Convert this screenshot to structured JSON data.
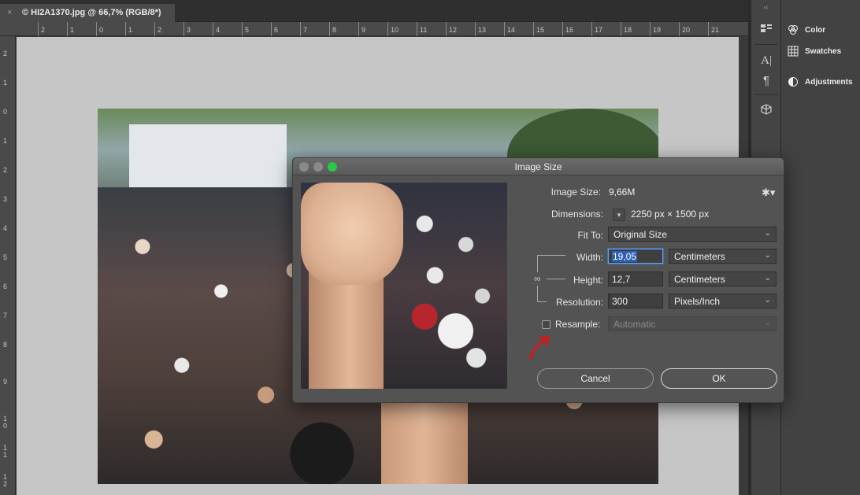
{
  "document_tab": {
    "title": "HI2A1370.jpg @ 66,7% (RGB/8*)",
    "close_glyph": "×",
    "modified_mark": "©"
  },
  "ruler_h": [
    "2",
    "1",
    "0",
    "1",
    "2",
    "3",
    "4",
    "5",
    "6",
    "7",
    "8",
    "9",
    "10",
    "11",
    "12",
    "13",
    "14",
    "15",
    "16",
    "17",
    "18",
    "19",
    "20",
    "21"
  ],
  "ruler_v": [
    "2",
    "1",
    "0",
    "1",
    "2",
    "3",
    "4",
    "5",
    "6",
    "7",
    "8",
    "9",
    "10",
    "11",
    "12"
  ],
  "dock": {
    "collapse_glyph": "‹‹",
    "tool_icons": [
      "libraries-icon",
      "character-icon",
      "paragraph-icon",
      "3d-icon"
    ],
    "panels": [
      {
        "label": "Color",
        "icon": "color-icon"
      },
      {
        "label": "Swatches",
        "icon": "swatches-icon"
      },
      {
        "label": "Adjustments",
        "icon": "adjustments-icon"
      }
    ]
  },
  "dialog": {
    "title": "Image Size",
    "image_size_label": "Image Size:",
    "image_size_value": "9,66M",
    "dimensions_label": "Dimensions:",
    "dimensions_value": "2250 px  ×  1500 px",
    "fit_to_label": "Fit To:",
    "fit_to_value": "Original Size",
    "width_label": "Width:",
    "width_value": "19,05",
    "width_unit": "Centimeters",
    "height_label": "Height:",
    "height_value": "12,7",
    "height_unit": "Centimeters",
    "resolution_label": "Resolution:",
    "resolution_value": "300",
    "resolution_unit": "Pixels/Inch",
    "resample_label": "Resample:",
    "resample_checked": false,
    "resample_value": "Automatic",
    "cancel_label": "Cancel",
    "ok_label": "OK",
    "traffic_lights": {
      "close": "#8a8a8a",
      "minimize": "#8a8a8a",
      "zoom": "#2ac845"
    }
  },
  "annotation": {
    "arrow_color": "#d21a1a"
  }
}
